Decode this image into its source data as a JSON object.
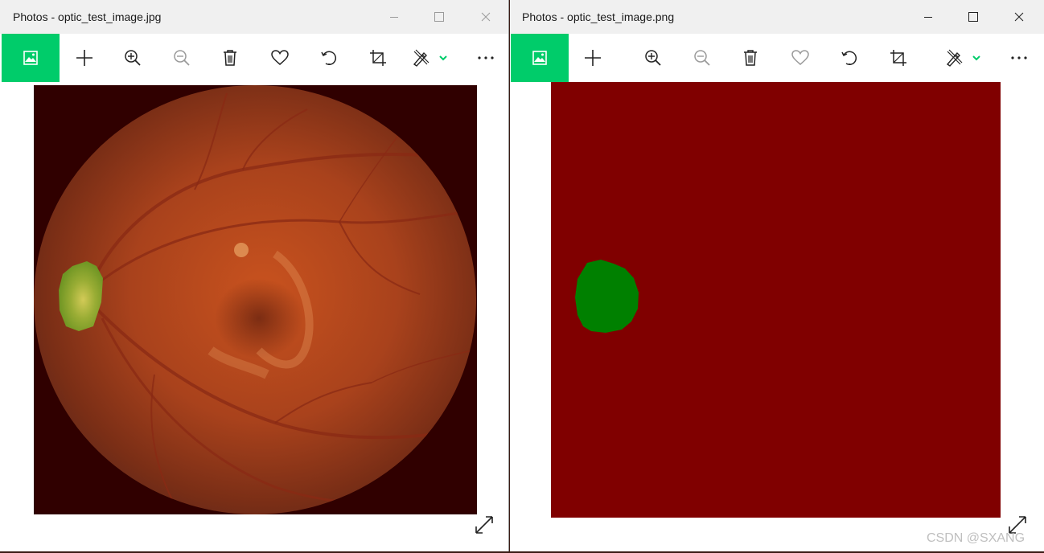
{
  "windows": {
    "left": {
      "title": "Photos - optic_test_image.jpg"
    },
    "right": {
      "title": "Photos - optic_test_image.png"
    }
  },
  "icons": {
    "home": "picture-icon",
    "add": "plus-icon",
    "zoom_in": "zoom-in-icon",
    "zoom_out": "zoom-out-icon",
    "delete": "trash-icon",
    "favorite": "heart-icon",
    "rotate": "rotate-icon",
    "crop": "crop-icon",
    "edit": "edit-draw-icon",
    "more": "ellipsis-icon",
    "expand": "expand-icon"
  },
  "colors": {
    "accent": "#00cc6a",
    "mask_background": "#800000",
    "mask_region": "#008000",
    "fundus_border": "#300000"
  },
  "watermark": "CSDN @SXANG"
}
